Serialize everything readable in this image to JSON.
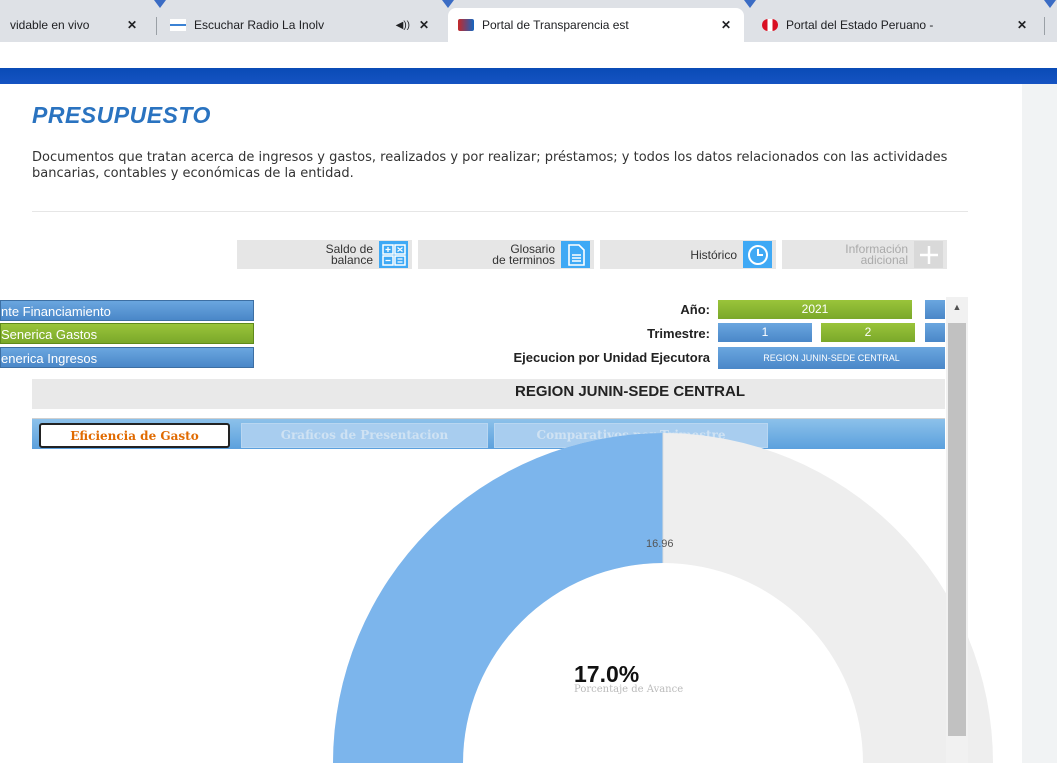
{
  "browser": {
    "tabs": [
      {
        "title": "vidable en vivo",
        "active": false
      },
      {
        "title": "Escuchar Radio La Inolv",
        "active": false,
        "audio_icon": "speaker-icon"
      },
      {
        "title": "Portal de Transparencia est",
        "active": true
      },
      {
        "title": "Portal del Estado Peruano -",
        "active": false
      }
    ]
  },
  "page": {
    "title": "PRESUPUESTO",
    "description": "Documentos que tratan acerca de ingresos y gastos, realizados y por realizar; préstamos; y todos los datos relacionados con las actividades bancarias, contables y económicas de la entidad."
  },
  "shortcuts": [
    {
      "line1": "Saldo de",
      "line2": "balance",
      "icon": "calculator-icon"
    },
    {
      "line1": "Glosario",
      "line2": "de terminos",
      "icon": "document-icon"
    },
    {
      "line1": "Histórico",
      "line2": "",
      "icon": "clock-icon"
    },
    {
      "line1": "Información",
      "line2": "adicional",
      "icon": "plus-icon"
    }
  ],
  "side_menu": [
    {
      "label": "nte Financiamiento",
      "color": "blue"
    },
    {
      "label": "Senerica Gastos",
      "color": "green"
    },
    {
      "label": "enerica Ingresos",
      "color": "blue"
    }
  ],
  "filters": {
    "year_label": "Año:",
    "year_value": "2021",
    "quarter_label": "Trimestre:",
    "quarters": [
      "1",
      "2"
    ],
    "unit_label": "Ejecucion por Unidad Ejecutora",
    "unit_value": "REGION JUNIN-SEDE CENTRAL"
  },
  "region_title": "REGION JUNIN-SEDE CENTRAL",
  "panel_tabs": [
    {
      "label": "Eficiencia de Gasto",
      "active": true
    },
    {
      "label": "Graficos de Presentacion",
      "active": false
    },
    {
      "label": "Comparativos por Trimestre",
      "active": false
    }
  ],
  "chart_data": {
    "type": "gauge",
    "value": 16.96,
    "min": 0,
    "max": 100,
    "value_label": "16.96",
    "display_value": "17.0%",
    "subtitle": "Porcentaje de Avance",
    "colors": {
      "filled": "#7cb5ec",
      "empty": "#eeeeee"
    }
  }
}
